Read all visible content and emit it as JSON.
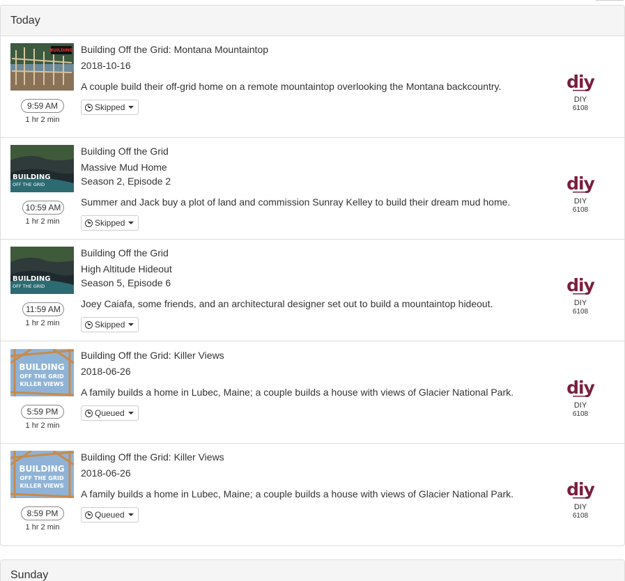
{
  "colors": {
    "diy_logo": "#7a1f3d",
    "heading_bg": "#f5f5f5",
    "border": "#dddddd"
  },
  "today": {
    "heading": "Today",
    "items": [
      {
        "title": "Building Off the Grid: Montana Mountaintop",
        "subtitle": "",
        "line2": "2018-10-16",
        "line3": "",
        "description": "A couple build their off-grid home on a remote mountaintop overlooking the Montana backcountry.",
        "time": "9:59 AM",
        "duration": "1 hr 2 min",
        "status": "Skipped",
        "status_icon": "clock-icon",
        "channel_name": "DIY",
        "channel_number": "6108",
        "thumb_text": "BUILDING",
        "thumb_kind": "construction"
      },
      {
        "title": "Building Off the Grid",
        "line2": "Massive Mud Home",
        "line3": "Season 2, Episode 2",
        "description": "Summer and Jack buy a plot of land and commission Sunray Kelley to build their dream mud home.",
        "time": "10:59 AM",
        "duration": "1 hr 2 min",
        "status": "Skipped",
        "status_icon": "clock-icon",
        "channel_name": "DIY",
        "channel_number": "6108",
        "thumb_text": "BUILDING",
        "thumb_sub": "OFF THE GRID",
        "thumb_kind": "cliff"
      },
      {
        "title": "Building Off the Grid",
        "line2": "High Altitude Hideout",
        "line3": "Season 5, Episode 6",
        "description": "Joey Caiafa, some friends, and an architectural designer set out to build a mountaintop hideout.",
        "time": "11:59 AM",
        "duration": "1 hr 2 min",
        "status": "Skipped",
        "status_icon": "clock-icon",
        "channel_name": "DIY",
        "channel_number": "6108",
        "thumb_text": "BUILDING",
        "thumb_sub": "OFF THE GRID",
        "thumb_kind": "cliff"
      },
      {
        "title": "Building Off the Grid: Killer Views",
        "line2": "2018-06-26",
        "line3": "",
        "description": "A family builds a home in Lubec, Maine; a couple builds a house with views of Glacier National Park.",
        "time": "5:59 PM",
        "duration": "1 hr 2 min",
        "status": "Queued",
        "status_icon": "clock-icon",
        "channel_name": "DIY",
        "channel_number": "6108",
        "thumb_text": "BUILDING",
        "thumb_sub": "OFF THE GRID",
        "thumb_sub2": "KILLER VIEWS",
        "thumb_kind": "frame"
      },
      {
        "title": "Building Off the Grid: Killer Views",
        "line2": "2018-06-26",
        "line3": "",
        "description": "A family builds a home in Lubec, Maine; a couple builds a house with views of Glacier National Park.",
        "time": "8:59 PM",
        "duration": "1 hr 2 min",
        "status": "Queued",
        "status_icon": "clock-icon",
        "channel_name": "DIY",
        "channel_number": "6108",
        "thumb_text": "BUILDING",
        "thumb_sub": "OFF THE GRID",
        "thumb_sub2": "KILLER VIEWS",
        "thumb_kind": "frame"
      }
    ]
  },
  "sunday": {
    "heading": "Sunday"
  },
  "logo_text": "diy"
}
